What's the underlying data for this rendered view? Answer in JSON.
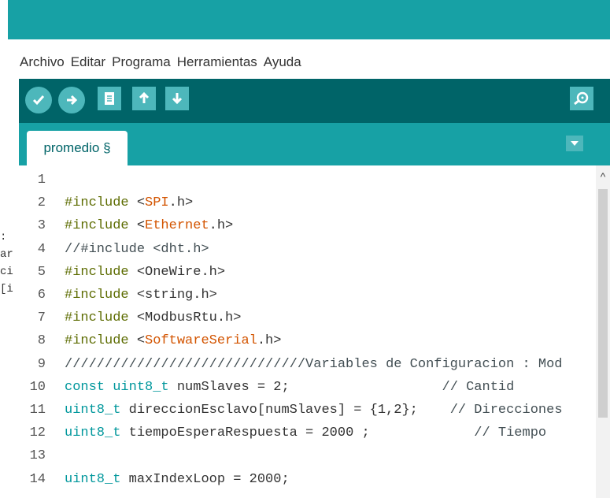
{
  "menu": [
    "Archivo",
    "Editar",
    "Programa",
    "Herramientas",
    "Ayuda"
  ],
  "tab": {
    "label": "promedio §"
  },
  "left_panel": [
    ":",
    "ar",
    "ci",
    "[i"
  ],
  "colors": {
    "titlebar": "#17a1a5",
    "toolbar": "#006468",
    "button": "#4db7bb",
    "include": "#5e6d03",
    "library": "#d35400",
    "type": "#00979c"
  },
  "lines": [
    {
      "n": "1",
      "parts": []
    },
    {
      "n": "2",
      "parts": [
        [
          "inc",
          "#include"
        ],
        [
          "txt",
          " <"
        ],
        [
          "lib",
          "SPI"
        ],
        [
          "txt",
          ".h>"
        ]
      ]
    },
    {
      "n": "3",
      "parts": [
        [
          "inc",
          "#include"
        ],
        [
          "txt",
          " <"
        ],
        [
          "lib",
          "Ethernet"
        ],
        [
          "txt",
          ".h>"
        ]
      ]
    },
    {
      "n": "4",
      "parts": [
        [
          "cmt",
          "//#include <dht.h>"
        ]
      ]
    },
    {
      "n": "5",
      "parts": [
        [
          "inc",
          "#include"
        ],
        [
          "txt",
          " <OneWire.h>"
        ]
      ]
    },
    {
      "n": "6",
      "parts": [
        [
          "inc",
          "#include"
        ],
        [
          "txt",
          " <string.h>"
        ]
      ]
    },
    {
      "n": "7",
      "parts": [
        [
          "inc",
          "#include"
        ],
        [
          "txt",
          " <ModbusRtu.h>"
        ]
      ]
    },
    {
      "n": "8",
      "parts": [
        [
          "inc",
          "#include"
        ],
        [
          "txt",
          " <"
        ],
        [
          "lib",
          "SoftwareSerial"
        ],
        [
          "txt",
          ".h>"
        ]
      ]
    },
    {
      "n": "9",
      "parts": [
        [
          "cmt",
          "//////////////////////////////Variables de Configuracion : Mod"
        ]
      ]
    },
    {
      "n": "10",
      "parts": [
        [
          "type",
          "const"
        ],
        [
          "txt",
          " "
        ],
        [
          "type",
          "uint8_t"
        ],
        [
          "txt",
          " numSlaves = 2;                   "
        ],
        [
          "cmt",
          "// Cantid"
        ]
      ]
    },
    {
      "n": "11",
      "parts": [
        [
          "type",
          "uint8_t"
        ],
        [
          "txt",
          " direccionEsclavo[numSlaves] = {1,2};    "
        ],
        [
          "cmt",
          "// Direcciones"
        ]
      ]
    },
    {
      "n": "12",
      "parts": [
        [
          "type",
          "uint8_t"
        ],
        [
          "txt",
          " tiempoEsperaRespuesta = 2000 ;             "
        ],
        [
          "cmt",
          "// Tiempo"
        ]
      ]
    },
    {
      "n": "13",
      "parts": []
    },
    {
      "n": "14",
      "parts": [
        [
          "type",
          "uint8_t"
        ],
        [
          "txt",
          " maxIndexLoop = 2000;"
        ]
      ]
    }
  ]
}
